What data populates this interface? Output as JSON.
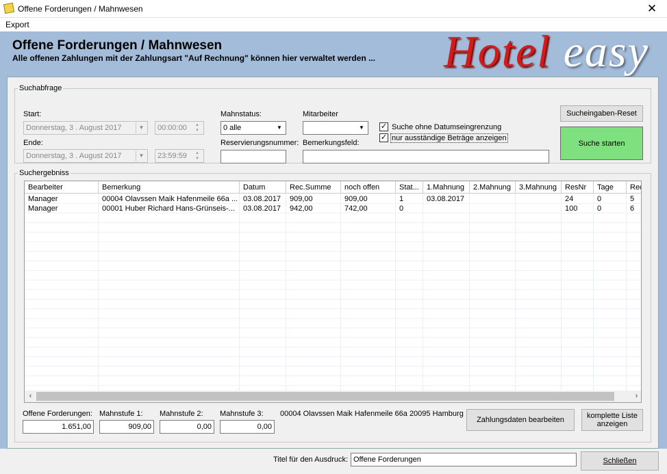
{
  "window": {
    "title": "Offene Forderungen / Mahnwesen",
    "close": "✕"
  },
  "menu": {
    "export": "Export"
  },
  "header": {
    "title": "Offene Forderungen / Mahnwesen",
    "subtitle": "Alle offenen Zahlungen mit der Zahlungsart \"Auf Rechnung\"  können hier verwaltet werden ...",
    "logo_part1": "Hotel",
    "logo_part2": "easy"
  },
  "search": {
    "legend": "Suchabfrage",
    "start_label": "Start:",
    "start_date": "Donnerstag,  3 .   August   2017",
    "start_time": "00:00:00",
    "end_label": "Ende:",
    "end_date": "Donnerstag,  3 .   August   2017",
    "end_time": "23:59:59",
    "mahnstatus_label": "Mahnstatus:",
    "mahnstatus_value": "0 alle",
    "mitarbeiter_label": "Mitarbeiter",
    "mitarbeiter_value": "",
    "reservierung_label": "Reservierungsnummer:",
    "reservierung_value": "",
    "bemerkung_label": "Bemerkungsfeld:",
    "bemerkung_value": "",
    "cb_ohne_datum": "Suche ohne Datumseingrenzung",
    "cb_ohne_datum_checked": "✓",
    "cb_ausstaendig": "nur ausständige Beträge anzeigen",
    "cb_ausstaendig_checked": "✓",
    "reset_button": "Sucheingaben-Reset",
    "search_button": "Suche starten"
  },
  "results": {
    "legend": "Suchergebniss",
    "columns": [
      "Bearbeiter",
      "Bemerkung",
      "Datum",
      "Rec.Summe",
      "noch offen",
      "Stat...",
      "1.Mahnung",
      "2.Mahnung",
      "3.Mahnung",
      "ResNr",
      "Tage",
      "Rec"
    ],
    "rows": [
      [
        "Manager",
        "00004 Olavssen Maik  Hafenmeile 66a ...",
        "03.08.2017",
        "909,00",
        "909,00",
        "1",
        "03.08.2017",
        "",
        "",
        "24",
        "0",
        "5"
      ],
      [
        "Manager",
        "00001 Huber Richard  Hans-Grünseis-...",
        "03.08.2017",
        "942,00",
        "742,00",
        "0",
        "",
        "",
        "",
        "100",
        "0",
        "6"
      ]
    ]
  },
  "summary": {
    "offene_label": "Offene Forderungen:",
    "offene_value": "1.651,00",
    "mahn1_label": "Mahnstufe 1:",
    "mahn1_value": "909,00",
    "mahn2_label": "Mahnstufe 2:",
    "mahn2_value": "0,00",
    "mahn3_label": "Mahnstufe 3:",
    "mahn3_value": "0,00",
    "selected_info": "00004 Olavssen Maik  Hafenmeile 66a 20095 Hamburg",
    "edit_button": "Zahlungsdaten bearbeiten",
    "full_list_button": "komplette Liste anzeigen"
  },
  "footer": {
    "print_title_label": "Titel für den Ausdruck:",
    "print_title_value": "Offene Forderungen",
    "close_button": "Schließen"
  }
}
